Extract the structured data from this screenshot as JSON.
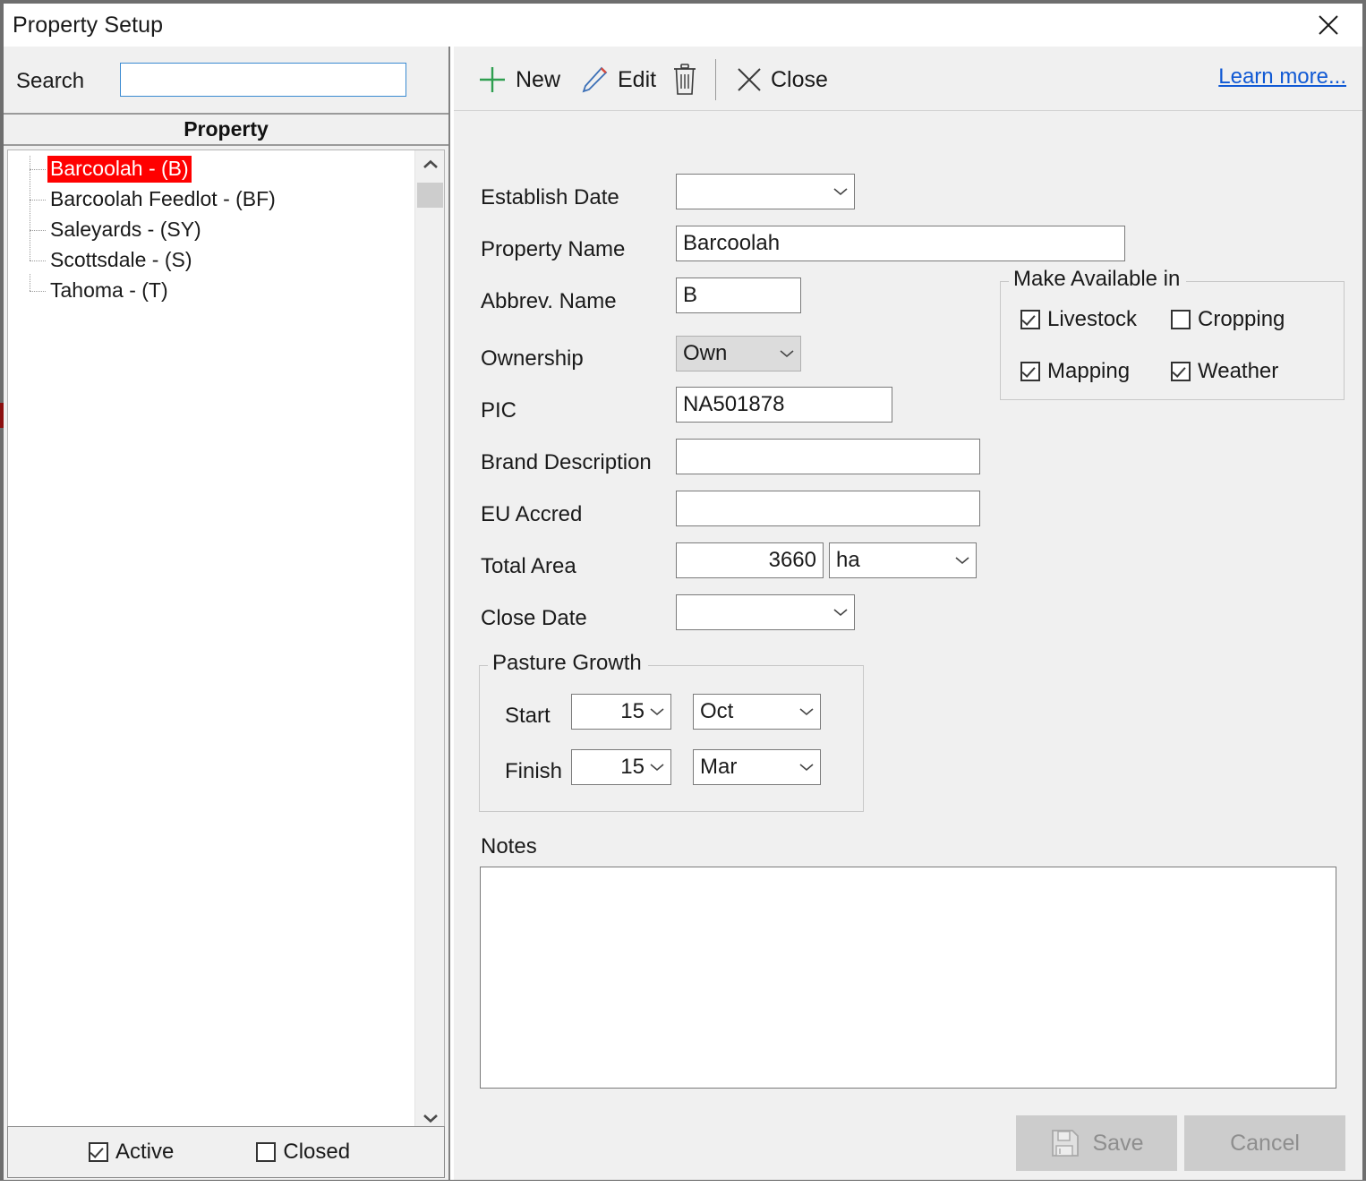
{
  "window": {
    "title": "Property Setup",
    "close_icon": "close-icon"
  },
  "left_panel": {
    "search": {
      "label": "Search",
      "value": "",
      "placeholder": ""
    },
    "column_header": "Property",
    "tree_items": [
      {
        "label": "Barcoolah - (B)",
        "selected": true
      },
      {
        "label": "Barcoolah Feedlot - (BF)",
        "selected": false
      },
      {
        "label": "Saleyards - (SY)",
        "selected": false
      },
      {
        "label": "Scottsdale - (S)",
        "selected": false
      },
      {
        "label": "Tahoma - (T)",
        "selected": false
      }
    ],
    "scrollbar": {
      "up_icon": "chevron-up-icon",
      "down_icon": "chevron-down-icon"
    },
    "filters": [
      {
        "label": "Active",
        "checked": true
      },
      {
        "label": "Closed",
        "checked": false
      }
    ],
    "selection_color": "#ff0000"
  },
  "toolbar": {
    "new_label": "New",
    "edit_label": "Edit",
    "delete_label": "",
    "close_label": "Close",
    "learn_more_label": "Learn more...",
    "link_color": "#1059d4",
    "new_icon_color": "#2e9e4f"
  },
  "form": {
    "establish_date": {
      "label": "Establish Date",
      "value": ""
    },
    "property_name": {
      "label": "Property Name",
      "value": "Barcoolah"
    },
    "abbrev_name": {
      "label": "Abbrev. Name",
      "value": "B"
    },
    "ownership": {
      "label": "Ownership",
      "value": "Own"
    },
    "pic": {
      "label": "PIC",
      "value": "NA501878"
    },
    "brand_description": {
      "label": "Brand Description",
      "value": ""
    },
    "eu_accred": {
      "label": "EU Accred",
      "value": ""
    },
    "total_area": {
      "label": "Total Area",
      "value": "3660",
      "unit": "ha"
    },
    "close_date": {
      "label": "Close Date",
      "value": ""
    },
    "make_available": {
      "title": "Make Available in",
      "options": [
        {
          "label": "Livestock",
          "checked": true
        },
        {
          "label": "Cropping",
          "checked": false
        },
        {
          "label": "Mapping",
          "checked": true
        },
        {
          "label": "Weather",
          "checked": true
        }
      ]
    },
    "pasture_growth": {
      "title": "Pasture Growth",
      "start": {
        "label": "Start",
        "day": "15",
        "month": "Oct"
      },
      "finish": {
        "label": "Finish",
        "day": "15",
        "month": "Mar"
      }
    },
    "notes": {
      "label": "Notes",
      "value": ""
    }
  },
  "footer": {
    "save_label": "Save",
    "cancel_label": "Cancel",
    "save_icon": "floppy-disk-icon"
  }
}
